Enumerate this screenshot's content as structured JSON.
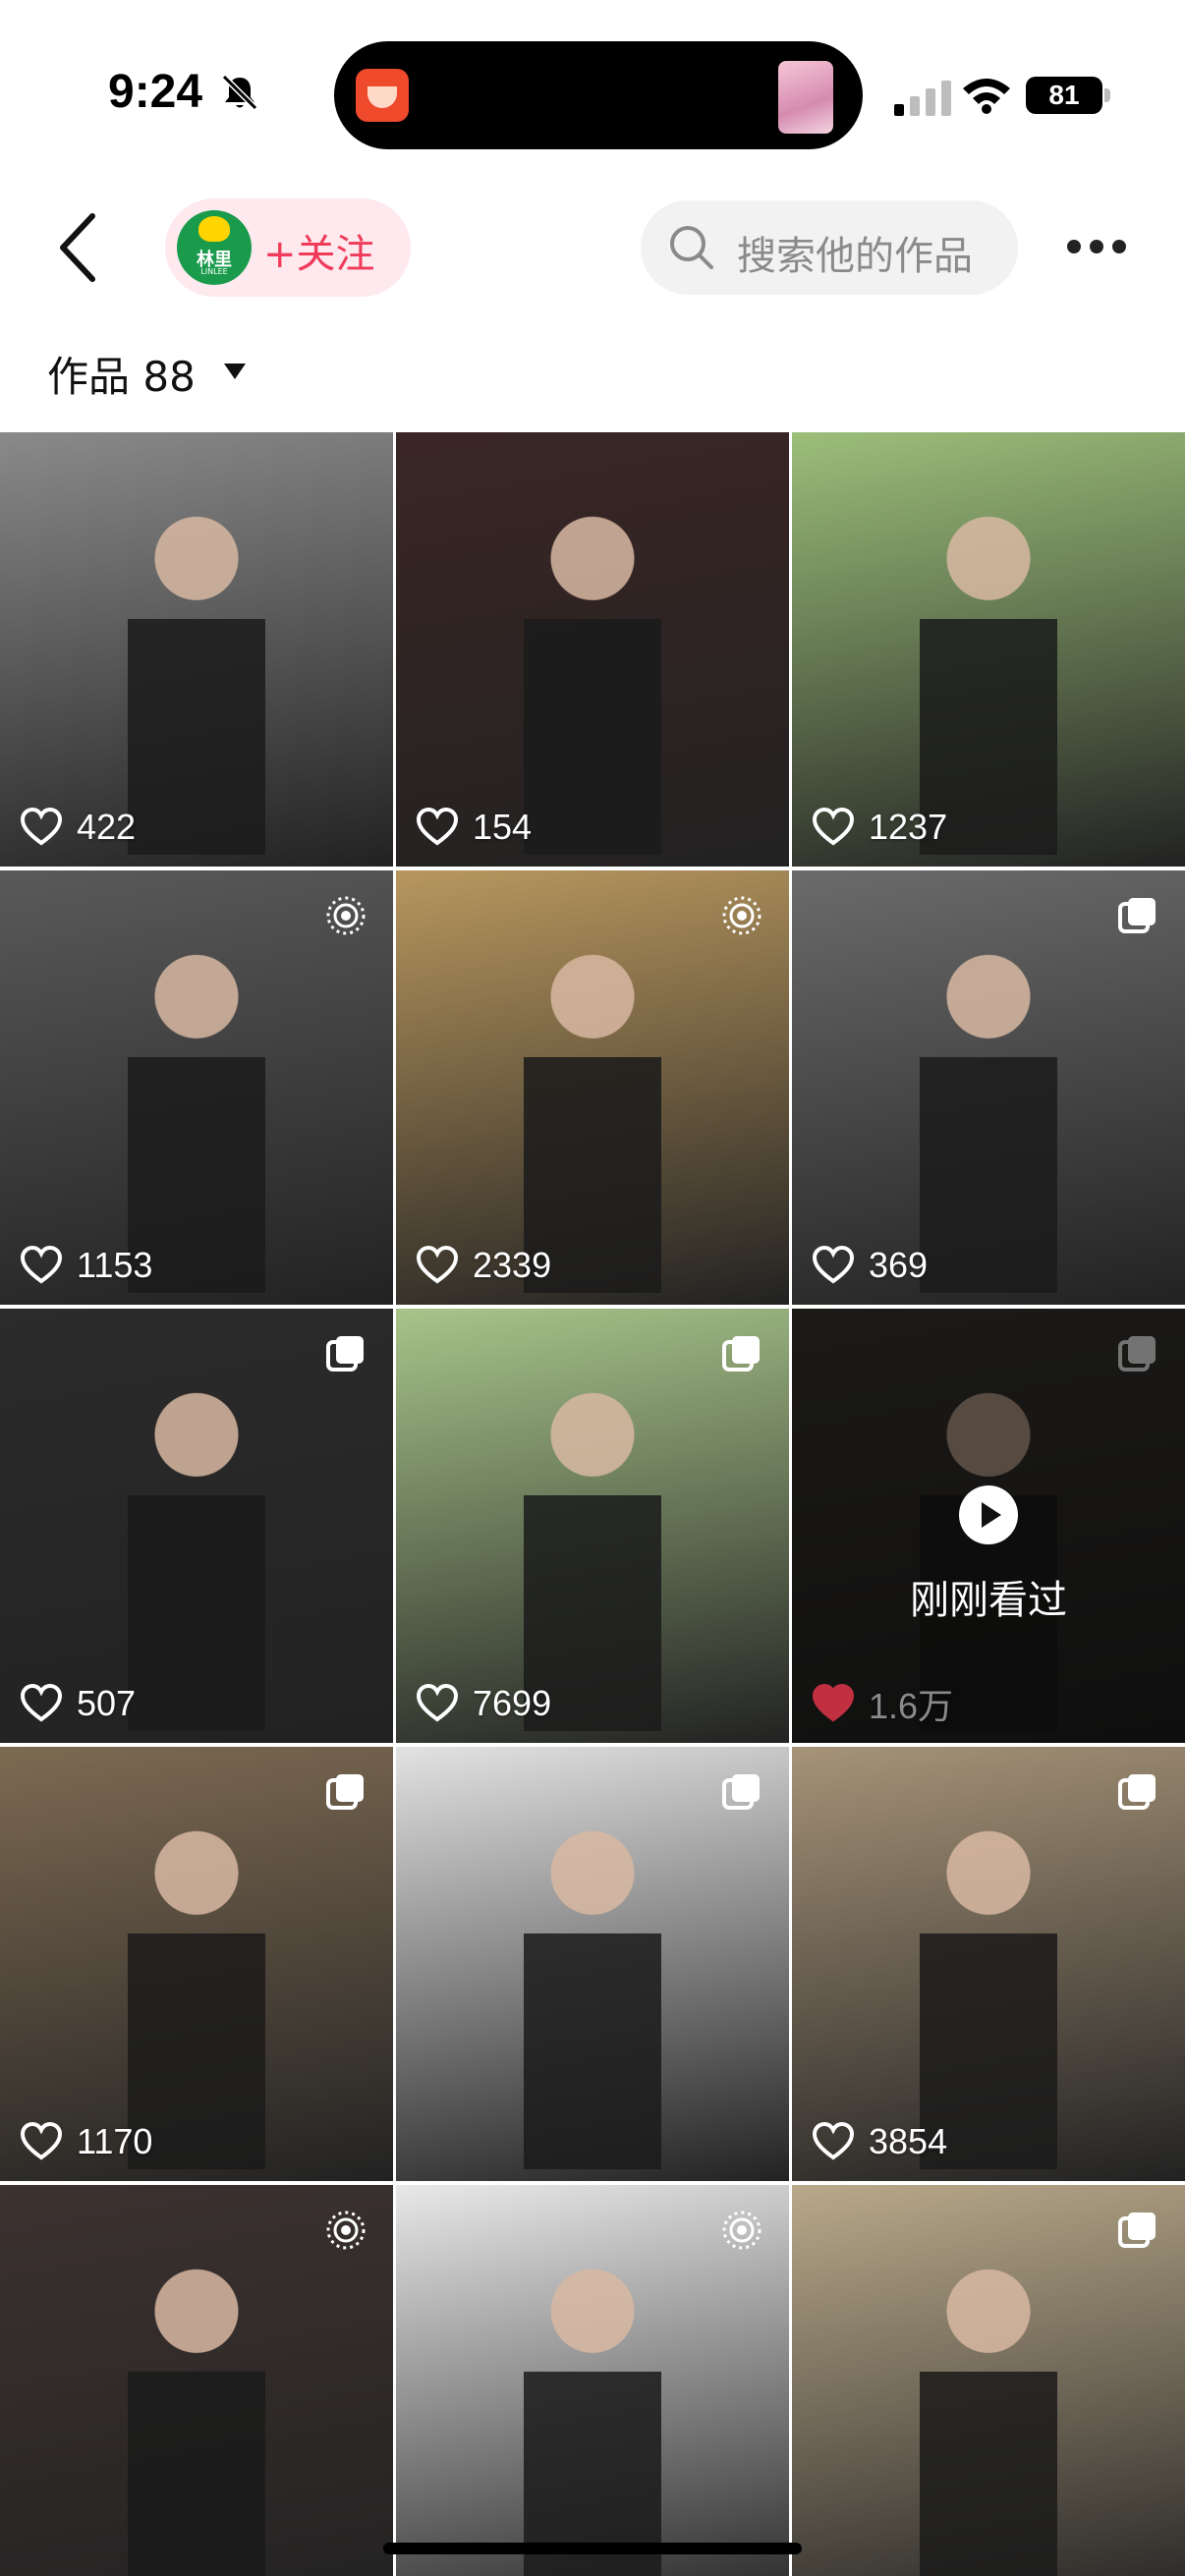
{
  "status_bar": {
    "time": "9:24",
    "battery": "81"
  },
  "header": {
    "avatar_text": "林里",
    "avatar_sub": "LINLEE",
    "follow_label": "+关注",
    "search_placeholder": "搜索他的作品"
  },
  "works_tab": {
    "label": "作品 88"
  },
  "grid": {
    "items": [
      {
        "likes": "422",
        "badge": "",
        "bg": "#8a8a8a"
      },
      {
        "likes": "154",
        "badge": "",
        "bg": "#3a2624"
      },
      {
        "likes": "1237",
        "badge": "",
        "bg": "#9cbf7a"
      },
      {
        "likes": "1153",
        "badge": "live-icon",
        "bg": "#5a5a5a"
      },
      {
        "likes": "2339",
        "badge": "live-icon",
        "bg": "#b8975e"
      },
      {
        "likes": "369",
        "badge": "gallery-icon",
        "bg": "#6b6b6b"
      },
      {
        "likes": "507",
        "badge": "gallery-icon",
        "bg": "#2b2b2b"
      },
      {
        "likes": "7699",
        "badge": "gallery-icon",
        "bg": "#a8c48a"
      },
      {
        "likes": "1.6万",
        "badge": "gallery-icon",
        "bg": "#3d3a34",
        "recently_viewed": "刚刚看过"
      },
      {
        "likes": "1170",
        "badge": "gallery-icon",
        "bg": "#7d6a52"
      },
      {
        "likes": "",
        "badge": "gallery-icon",
        "bg": "#e2e2e2"
      },
      {
        "likes": "3854",
        "badge": "gallery-icon",
        "bg": "#a69378"
      },
      {
        "likes": "",
        "badge": "live-icon",
        "bg": "#3c3230"
      },
      {
        "likes": "",
        "badge": "live-icon",
        "bg": "#e8e8e8"
      },
      {
        "likes": "",
        "badge": "gallery-icon",
        "bg": "#b9a98a"
      }
    ]
  }
}
